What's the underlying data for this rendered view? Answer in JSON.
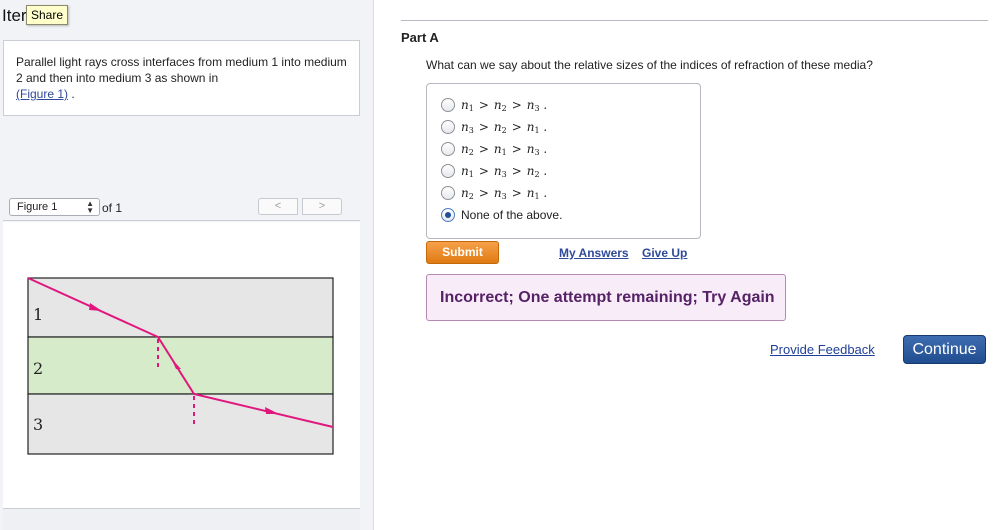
{
  "item": {
    "title": "Iter",
    "share_tooltip": "Share"
  },
  "intro": {
    "text": "Parallel light rays cross interfaces from medium 1 into medium 2 and then into medium 3 as shown in",
    "figure_link": "(Figure 1)",
    "trailing": " ."
  },
  "figure_nav": {
    "selected": "Figure 1",
    "of_label": "of 1",
    "prev_icon": "chevron-left-icon",
    "next_icon": "chevron-right-icon",
    "prev_glyph": "<",
    "next_glyph": ">"
  },
  "figure": {
    "medium_labels": [
      "1",
      "2",
      "3"
    ],
    "colors": {
      "medium1": "#e6e6e6",
      "medium2": "#d5ebc9",
      "medium3": "#e6e6e6",
      "ray": "#e0177e"
    }
  },
  "part": {
    "label": "Part A",
    "question": "What can we say about the relative sizes of the indices of refraction of these media?"
  },
  "choices": [
    {
      "text": "n1 > n2 > n3.",
      "selected": false
    },
    {
      "text": "n3 > n2 > n1.",
      "selected": false
    },
    {
      "text": "n2 > n1 > n3.",
      "selected": false
    },
    {
      "text": "n1 > n3 > n2.",
      "selected": false
    },
    {
      "text": "n2 > n3 > n1.",
      "selected": false
    },
    {
      "text": "None of the above.",
      "selected": true
    }
  ],
  "actions": {
    "submit": "Submit",
    "my_answers": "My Answers",
    "give_up": "Give Up"
  },
  "feedback": {
    "message": "Incorrect; One attempt remaining; Try Again"
  },
  "footer": {
    "provide_feedback": "Provide Feedback",
    "continue": "Continue"
  },
  "colors": {
    "submit": "#ef8c26",
    "continue": "#2b5a9e",
    "feedback_bg": "#f9ecf9",
    "feedback_text": "#552266"
  }
}
